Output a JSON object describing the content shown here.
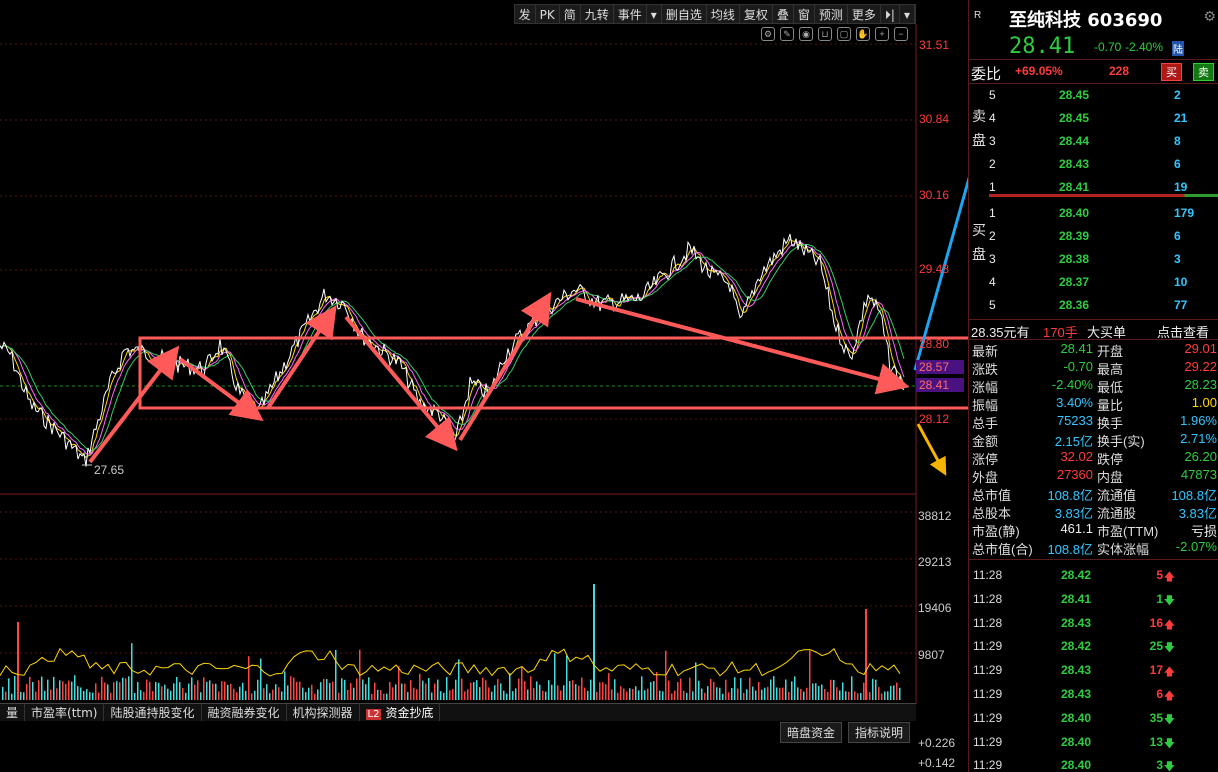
{
  "toolbar": {
    "items": [
      "发",
      "PK",
      "简",
      "九转",
      "事件",
      "▾",
      "删自选",
      "均线",
      "复权",
      "叠",
      "窗",
      "预测",
      "更多",
      "⏵|",
      "▾"
    ]
  },
  "chart": {
    "price_ticks": [
      "31.51",
      "30.84",
      "30.16",
      "29.48",
      "28.80",
      "28.12"
    ],
    "low_label": "27.65",
    "tag_high": "28.57",
    "tag_last": "28.41",
    "volume_ticks": [
      "38812",
      "29213",
      "19406",
      "9807"
    ],
    "indicator_ticks": [
      "+0.226",
      "+0.142"
    ]
  },
  "bottom_tabs": {
    "items": [
      "量",
      "市盈率(ttm)",
      "陆股通持股变化",
      "融资融券变化",
      "机构探测器",
      "资金抄底"
    ],
    "l2_badge": "L2"
  },
  "bottom_buttons": {
    "dark_fund": "暗盘资金",
    "indicator_help": "指标说明"
  },
  "stock": {
    "r_mark": "R",
    "name_code": "至纯科技 603690",
    "last": "28.41",
    "change": "-0.70",
    "change_pct": "-2.40%",
    "lu": "陆"
  },
  "weibi": {
    "label": "委比",
    "pct": "+69.05%",
    "diff": "228",
    "buy": "买",
    "sell": "卖"
  },
  "order_book": {
    "sell_label": [
      "卖",
      "盘"
    ],
    "buy_label": [
      "买",
      "盘"
    ],
    "sells": [
      {
        "level": "5",
        "price": "28.45",
        "vol": "2"
      },
      {
        "level": "4",
        "price": "28.45",
        "vol": "21"
      },
      {
        "level": "3",
        "price": "28.44",
        "vol": "8"
      },
      {
        "level": "2",
        "price": "28.43",
        "vol": "6"
      },
      {
        "level": "1",
        "price": "28.41",
        "vol": "19"
      }
    ],
    "buys": [
      {
        "level": "1",
        "price": "28.40",
        "vol": "179"
      },
      {
        "level": "2",
        "price": "28.39",
        "vol": "6"
      },
      {
        "level": "3",
        "price": "28.38",
        "vol": "3"
      },
      {
        "level": "4",
        "price": "28.37",
        "vol": "10"
      },
      {
        "level": "5",
        "price": "28.36",
        "vol": "77"
      }
    ]
  },
  "big_order": {
    "price_text": "28.35元有",
    "lots": "170手",
    "label": "大买单",
    "link": "点击查看"
  },
  "stats": [
    {
      "k1": "最新",
      "v1": "28.41",
      "c1": "green",
      "k2": "开盘",
      "v2": "29.01",
      "c2": "red"
    },
    {
      "k1": "涨跌",
      "v1": "-0.70",
      "c1": "green",
      "k2": "最高",
      "v2": "29.22",
      "c2": "red"
    },
    {
      "k1": "涨幅",
      "v1": "-2.40%",
      "c1": "green",
      "k2": "最低",
      "v2": "28.23",
      "c2": "green"
    },
    {
      "k1": "振幅",
      "v1": "3.40%",
      "c1": "cyan",
      "k2": "量比",
      "v2": "1.00",
      "c2": "yellow"
    },
    {
      "k1": "总手",
      "v1": "75233",
      "c1": "cyan",
      "k2": "换手",
      "v2": "1.96%",
      "c2": "cyan"
    },
    {
      "k1": "金额",
      "v1": "2.15亿",
      "c1": "cyan",
      "k2": "换手(实)",
      "v2": "2.71%",
      "c2": "cyan"
    },
    {
      "k1": "涨停",
      "v1": "32.02",
      "c1": "red",
      "k2": "跌停",
      "v2": "26.20",
      "c2": "green"
    },
    {
      "k1": "外盘",
      "v1": "27360",
      "c1": "red",
      "k2": "内盘",
      "v2": "47873",
      "c2": "green"
    },
    {
      "k1": "总市值",
      "v1": "108.8亿",
      "c1": "cyan",
      "k2": "流通值",
      "v2": "108.8亿",
      "c2": "cyan"
    },
    {
      "k1": "总股本",
      "v1": "3.83亿",
      "c1": "cyan",
      "k2": "流通股",
      "v2": "3.83亿",
      "c2": "cyan"
    },
    {
      "k1": "市盈(静)",
      "v1": "461.1",
      "c1": "white",
      "k2": "市盈(TTM)",
      "v2": "亏损",
      "c2": "white"
    },
    {
      "k1": "总市值(合)",
      "v1": "108.8亿",
      "c1": "cyan",
      "k2": "实体涨幅",
      "v2": "-2.07%",
      "c2": "green"
    }
  ],
  "ticks": [
    {
      "time": "11:28",
      "price": "28.42",
      "pc": "green",
      "vol": "5",
      "vc": "red",
      "dir": "up"
    },
    {
      "time": "11:28",
      "price": "28.41",
      "pc": "green",
      "vol": "1",
      "vc": "green",
      "dir": "down"
    },
    {
      "time": "11:28",
      "price": "28.43",
      "pc": "green",
      "vol": "16",
      "vc": "red",
      "dir": "up"
    },
    {
      "time": "11:29",
      "price": "28.42",
      "pc": "green",
      "vol": "25",
      "vc": "green",
      "dir": "down"
    },
    {
      "time": "11:29",
      "price": "28.43",
      "pc": "green",
      "vol": "17",
      "vc": "red",
      "dir": "up"
    },
    {
      "time": "11:29",
      "price": "28.43",
      "pc": "green",
      "vol": "6",
      "vc": "red",
      "dir": "up"
    },
    {
      "time": "11:29",
      "price": "28.40",
      "pc": "green",
      "vol": "35",
      "vc": "green",
      "dir": "down"
    },
    {
      "time": "11:29",
      "price": "28.40",
      "pc": "green",
      "vol": "13",
      "vc": "green",
      "dir": "down"
    },
    {
      "time": "11:29",
      "price": "28.40",
      "pc": "green",
      "vol": "3",
      "vc": "green",
      "dir": "down"
    }
  ]
}
